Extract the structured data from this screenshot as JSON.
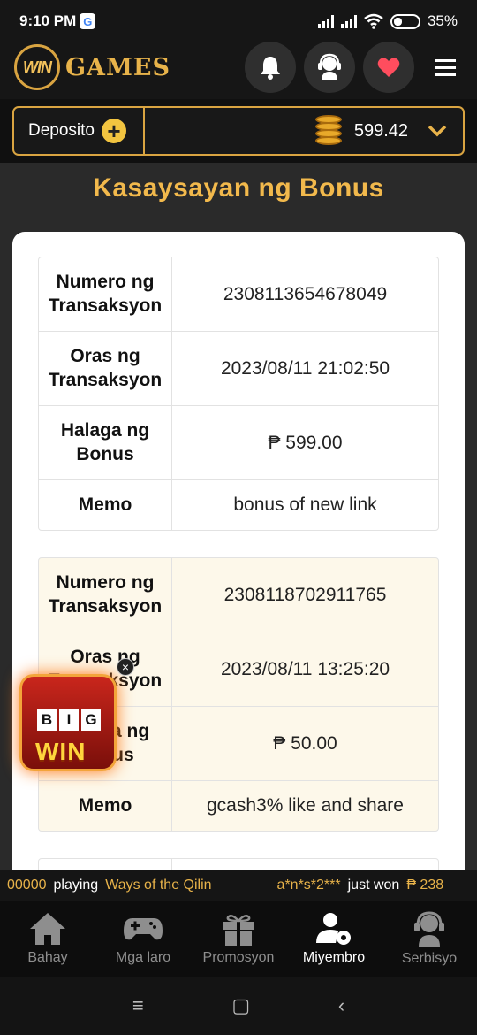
{
  "status": {
    "time": "9:10 PM",
    "battery": "35%",
    "g_badge": "G"
  },
  "header": {
    "logo_mark": "WIN",
    "logo_text": "GAMES"
  },
  "wallet": {
    "deposit_label": "Deposito",
    "balance": "599.42"
  },
  "page": {
    "title": "Kasaysayan ng Bonus"
  },
  "records": [
    {
      "rows": [
        {
          "label": "Numero ng Transaksyon",
          "value": "2308113654678049"
        },
        {
          "label": "Oras ng Transaksyon",
          "value": "2023/08/11 21:02:50"
        },
        {
          "label": "Halaga ng Bonus",
          "value": "₱ 599.00"
        },
        {
          "label": "Memo",
          "value": "bonus of new link"
        }
      ]
    },
    {
      "rows": [
        {
          "label": "Numero ng Transaksyon",
          "value": "2308118702911765"
        },
        {
          "label": "Oras ng Transaksyon",
          "value": "2023/08/11 13:25:20"
        },
        {
          "label": "Halaga ng Bonus",
          "value": "₱ 50.00"
        },
        {
          "label": "Memo",
          "value": "gcash3% like and share"
        }
      ]
    }
  ],
  "bigwin": {
    "line1": [
      "B",
      "I",
      "G"
    ],
    "line2": "WIN",
    "close": "×"
  },
  "ticker": {
    "amount_prefix": "00000",
    "playing_label": "playing",
    "game": "Ways of the Qilin",
    "user": "a*n*s*2***",
    "won_label": "just won",
    "won_amount": "₱ 238"
  },
  "nav": {
    "items": [
      {
        "label": "Bahay",
        "icon": "home-icon",
        "active": false
      },
      {
        "label": "Mga laro",
        "icon": "gamepad-icon",
        "active": false
      },
      {
        "label": "Promosyon",
        "icon": "gift-icon",
        "active": false
      },
      {
        "label": "Miyembro",
        "icon": "member-settings-icon",
        "active": true
      },
      {
        "label": "Serbisyo",
        "icon": "support-agent-icon",
        "active": false
      }
    ]
  },
  "system_nav": {
    "menu": "≡",
    "home": "▢",
    "back": "‹"
  },
  "colors": {
    "gold": "#e8b34a",
    "title_gold": "#f2b94c",
    "bell": "#ffffff",
    "heart": "#ff4d5e",
    "coin_yellow": "#f2c440"
  }
}
